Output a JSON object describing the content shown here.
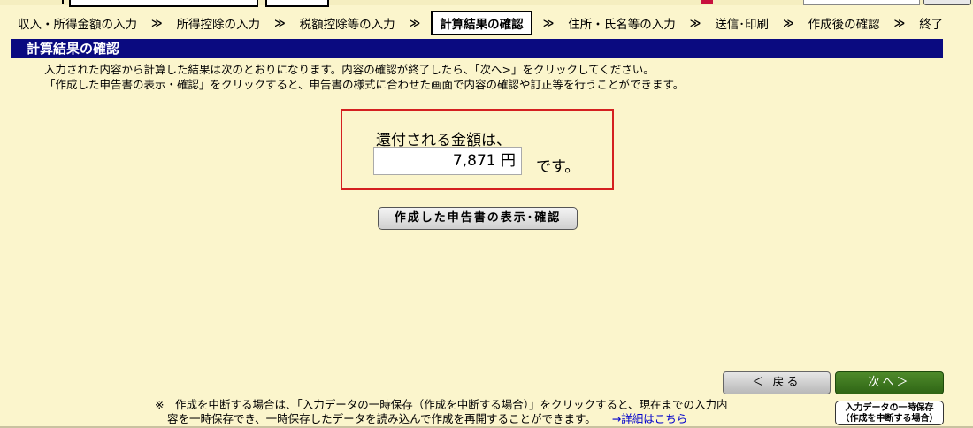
{
  "steps": [
    {
      "label": "収入・所得金額の入力",
      "active": false
    },
    {
      "label": "所得控除の入力",
      "active": false
    },
    {
      "label": "税額控除等の入力",
      "active": false
    },
    {
      "label": "計算結果の確認",
      "active": true
    },
    {
      "label": "住所・氏名等の入力",
      "active": false
    },
    {
      "label": "送信･印刷",
      "active": false
    },
    {
      "label": "作成後の確認",
      "active": false
    },
    {
      "label": "終了",
      "active": false
    }
  ],
  "step_separator": "≫",
  "section": {
    "title": "計算結果の確認"
  },
  "intro": {
    "line1": "入力された内容から計算した結果は次のとおりになります。内容の確認が終了したら、「次へ>」をクリックしてください。",
    "line2": "「作成した申告書の表示・確認」をクリックすると、申告書の様式に合わせた画面で内容の確認や訂正等を行うことができます。"
  },
  "result": {
    "label": "還付される金額は、",
    "amount": "7,871 円",
    "suffix": "です。"
  },
  "buttons": {
    "view": "作成した申告書の表示･確認",
    "back": "＜ 戻る",
    "next": "次へ＞",
    "save_line1": "入力データの一時保存",
    "save_line2": "（作成を中断する場合）"
  },
  "note": {
    "line1": "※　作成を中断する場合は、「入力データの一時保存（作成を中断する場合）」をクリックすると、現在までの入力内",
    "line2": "容を一時保存でき、一時保存したデータを読み込んで作成を再開することができます。",
    "link": "→詳細はこちら"
  },
  "colors": {
    "page_bg": "#fbf5cc",
    "header_bg": "#0a0a80",
    "result_border": "#d42020",
    "next_bg": "#2f6515",
    "link": "#0000cc"
  }
}
